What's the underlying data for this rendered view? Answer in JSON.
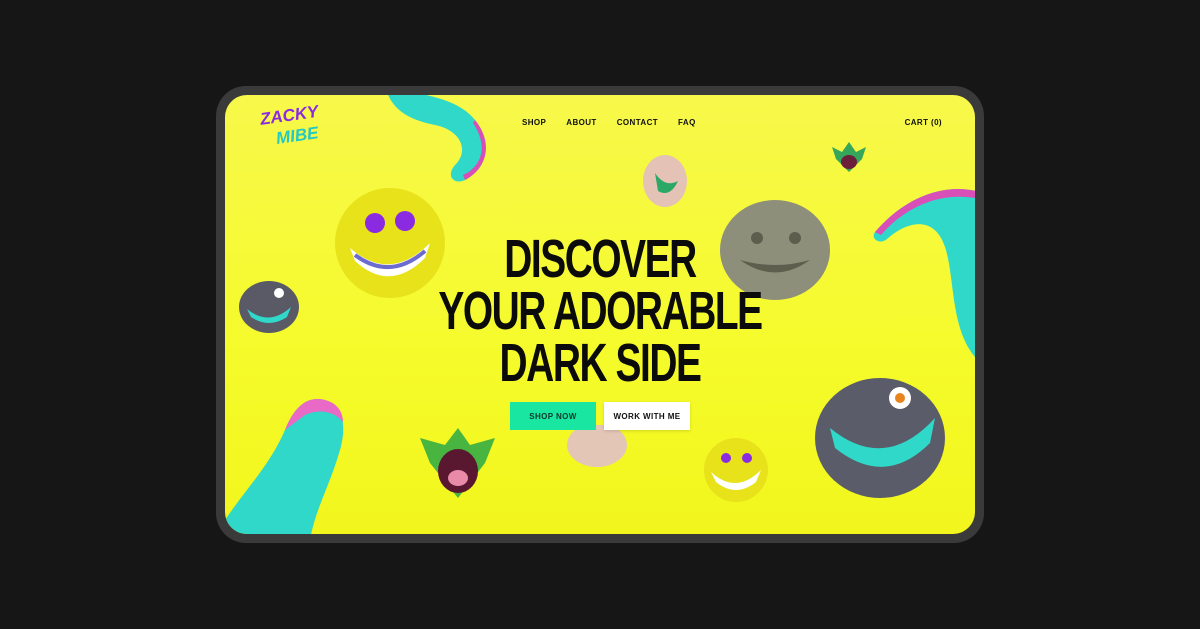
{
  "brand": {
    "logo_text_top": "ZACKY",
    "logo_text_bottom": "MIBE"
  },
  "nav": {
    "items": [
      {
        "label": "SHOP"
      },
      {
        "label": "ABOUT"
      },
      {
        "label": "CONTACT"
      },
      {
        "label": "FAQ"
      }
    ]
  },
  "cart": {
    "label": "CART (0)"
  },
  "hero": {
    "line1": "DISCOVER",
    "line2": "YOUR ADORABLE",
    "line3": "DARK SIDE",
    "primary_button": "SHOP NOW",
    "secondary_button": "WORK WITH ME"
  },
  "colors": {
    "page_background": "#161616",
    "hero_background": "#f5f92e",
    "primary_button": "#19e6a0",
    "tentacle": "#2fd8c8",
    "sucker": "#d94fb8"
  }
}
